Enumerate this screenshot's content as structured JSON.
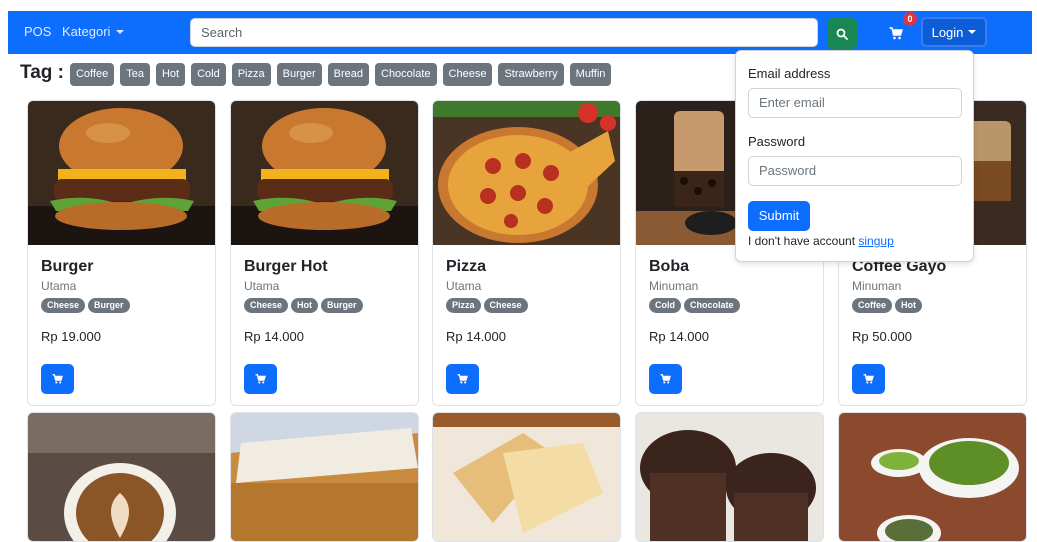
{
  "navbar": {
    "brand": "POS",
    "kategori_label": "Kategori",
    "search_placeholder": "Search",
    "cart_count": "0",
    "login_label": "Login"
  },
  "tags": {
    "title": "Tag :",
    "items": [
      "Coffee",
      "Tea",
      "Hot",
      "Cold",
      "Pizza",
      "Burger",
      "Bread",
      "Chocolate",
      "Cheese",
      "Strawberry",
      "Muffin"
    ]
  },
  "products": [
    {
      "name": "Burger",
      "category": "Utama",
      "tags": [
        "Cheese",
        "Burger"
      ],
      "price": "Rp 19.000",
      "image": "burger"
    },
    {
      "name": "Burger Hot",
      "category": "Utama",
      "tags": [
        "Cheese",
        "Hot",
        "Burger"
      ],
      "price": "Rp 14.000",
      "image": "burger"
    },
    {
      "name": "Pizza",
      "category": "Utama",
      "tags": [
        "Pizza",
        "Cheese"
      ],
      "price": "Rp 14.000",
      "image": "pizza"
    },
    {
      "name": "Boba",
      "category": "Minuman",
      "tags": [
        "Cold",
        "Chocolate"
      ],
      "price": "Rp 14.000",
      "image": "boba"
    },
    {
      "name": "Coffee Gayo",
      "category": "Minuman",
      "tags": [
        "Coffee",
        "Hot"
      ],
      "price": "Rp 50.000",
      "image": "coffee"
    }
  ],
  "second_row_images": [
    "latte-art",
    "cheese-bread",
    "white-bread",
    "chocolate-muffin",
    "green-tea"
  ],
  "login_dropdown": {
    "email_label": "Email address",
    "email_placeholder": "Enter email",
    "password_label": "Password",
    "password_placeholder": "Password",
    "submit_label": "Submit",
    "no_account_text": "I don't have account",
    "signup_link": "singup"
  },
  "colors": {
    "primary": "#0d6efd",
    "success": "#198754",
    "secondary": "#6c757d",
    "danger": "#dc3545"
  }
}
